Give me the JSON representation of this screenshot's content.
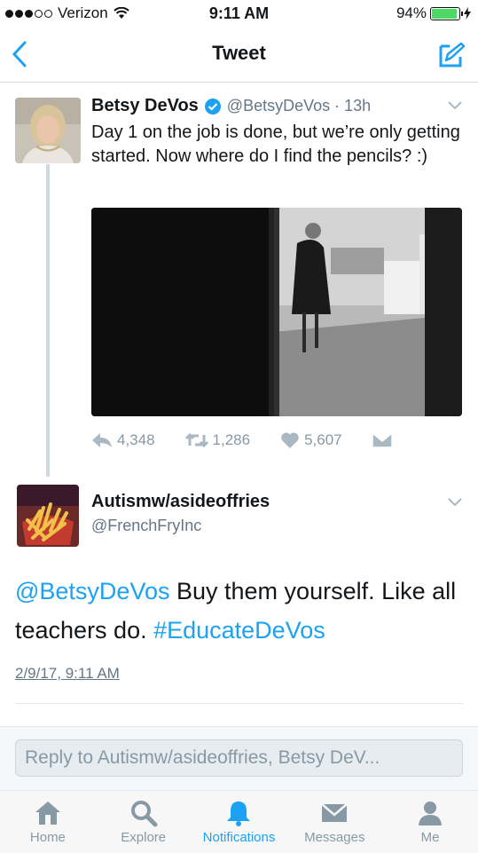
{
  "status": {
    "carrier": "Verizon",
    "time": "9:11 AM",
    "battery": "94%"
  },
  "nav": {
    "title": "Tweet"
  },
  "tweet": {
    "name": "Betsy DeVos",
    "handle": "@BetsyDeVos · 13h",
    "text": "Day 1 on the job is done, but we’re only getting started. Now where do I find the pencils? :)",
    "replies": "4,348",
    "retweets": "1,286",
    "likes": "5,607"
  },
  "reply": {
    "name": "Autismw/asideoffries",
    "handle": "@FrenchFryInc",
    "mention": "@BetsyDeVos",
    "text": " Buy them yourself. Like all teachers do.  ",
    "hashtag": "#EducateDeVos",
    "date": "2/9/17, 9:11 AM"
  },
  "reply_bar": {
    "placeholder": "Reply to Autismw/asideoffries, Betsy DeV..."
  },
  "tabs": [
    {
      "label": "Home",
      "icon": "home-icon"
    },
    {
      "label": "Explore",
      "icon": "search-icon"
    },
    {
      "label": "Notifications",
      "icon": "bell-icon"
    },
    {
      "label": "Messages",
      "icon": "envelope-icon"
    },
    {
      "label": "Me",
      "icon": "person-icon"
    }
  ],
  "colors": {
    "accent": "#1da1f2",
    "muted": "#8899a6",
    "verified": "#1da1f2"
  }
}
